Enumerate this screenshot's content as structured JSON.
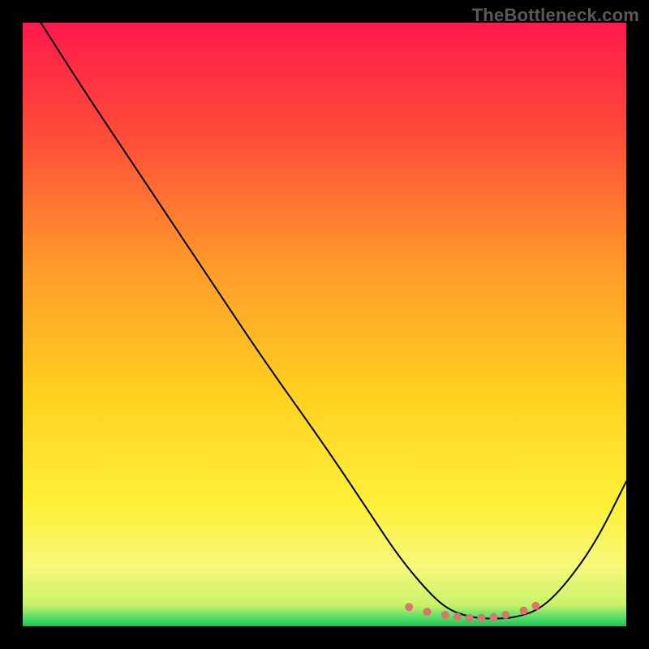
{
  "watermark": "TheBottleneck.com",
  "colors": {
    "top": "#ff1a4b",
    "mid_upper": "#ff7a2e",
    "mid": "#ffe02a",
    "lower": "#fdf87a",
    "bottom_band": "#ecf98a",
    "green": "#27d35a",
    "curve": "#000000",
    "dots": "#d9776e",
    "frame": "#000000"
  },
  "chart_data": {
    "type": "line",
    "title": "",
    "xlabel": "",
    "ylabel": "",
    "xlim": [
      0,
      100
    ],
    "ylim": [
      0,
      100
    ],
    "series": [
      {
        "name": "bottleneck-curve",
        "x": [
          3,
          10,
          20,
          30,
          40,
          50,
          58,
          62,
          66,
          70,
          74,
          78,
          82,
          86,
          90,
          95,
          100
        ],
        "values": [
          100,
          89,
          74,
          59,
          44,
          30,
          18,
          12,
          7,
          3,
          1.5,
          1.2,
          1.5,
          3,
          7,
          14,
          24
        ]
      }
    ],
    "highlight_dots": {
      "name": "optimal-range",
      "x": [
        64,
        67,
        70,
        72,
        74,
        76,
        78,
        80,
        83,
        85
      ],
      "y": [
        3.2,
        2.4,
        1.9,
        1.6,
        1.4,
        1.4,
        1.5,
        1.9,
        2.6,
        3.4
      ]
    }
  }
}
